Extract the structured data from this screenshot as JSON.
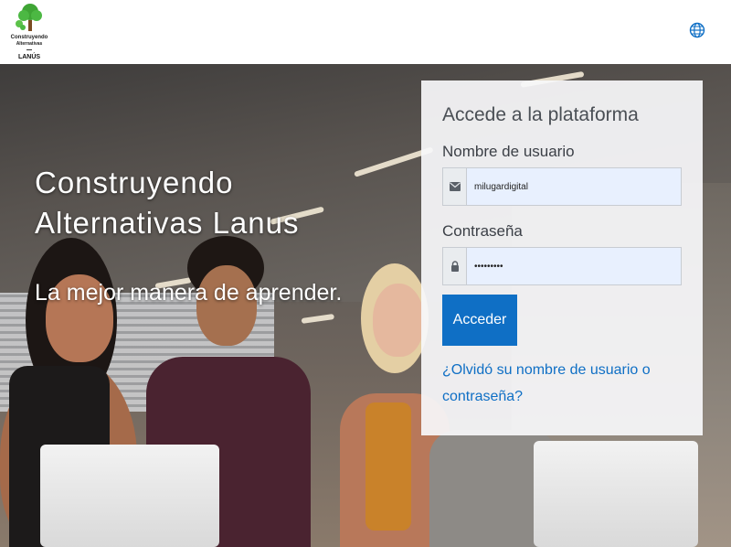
{
  "header": {
    "logo": {
      "line1": "Construyendo",
      "line2": "Alternativas",
      "line3": "LANÚS"
    },
    "language_icon": "globe-icon"
  },
  "hero": {
    "title": "Construyendo Alternativas Lanus",
    "subtitle": "La mejor manera de aprender."
  },
  "login": {
    "heading": "Accede a la plataforma",
    "username_label": "Nombre de usuario",
    "username_value": "milugardigital",
    "username_icon": "envelope-icon",
    "password_label": "Contraseña",
    "password_value": "•••••••••",
    "password_icon": "lock-icon",
    "submit_label": "Acceder",
    "forgot_link": "¿Olvidó su nombre de usuario o contraseña?"
  },
  "colors": {
    "primary": "#0f6fc5",
    "input_bg": "#e8f0fe"
  }
}
